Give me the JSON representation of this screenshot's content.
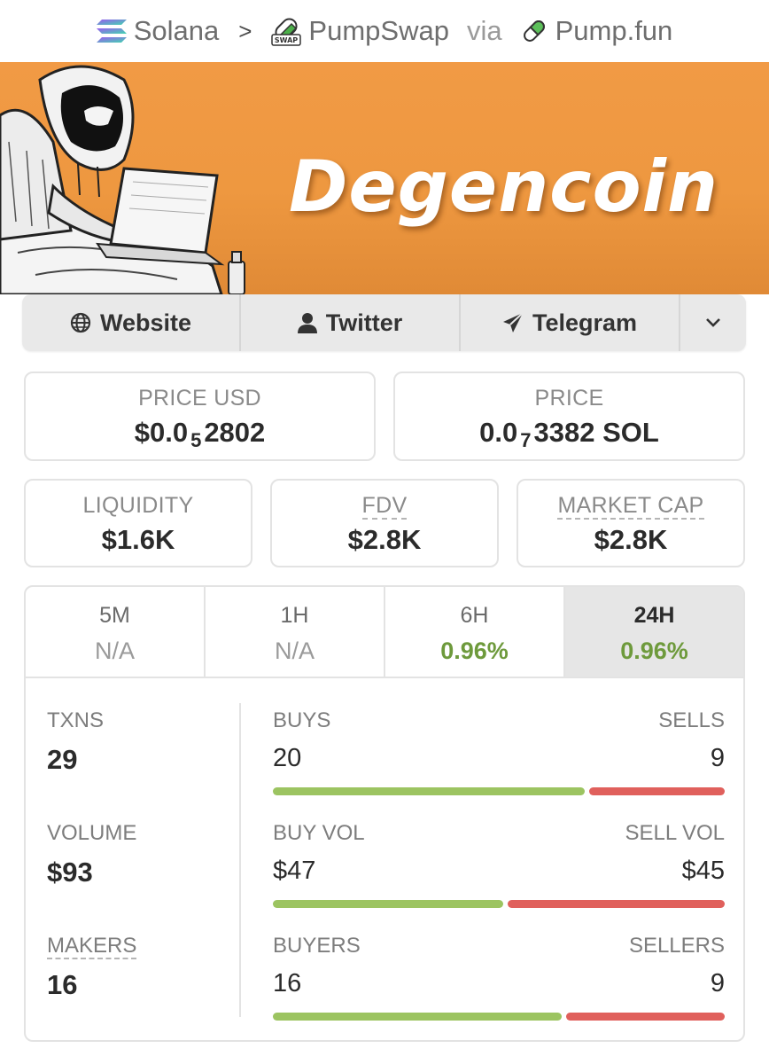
{
  "breadcrumb": {
    "chain": "Solana",
    "dex": "PumpSwap",
    "via": "via",
    "launchpad": "Pump.fun"
  },
  "banner": {
    "title": "Degencoin"
  },
  "links": {
    "website": "Website",
    "twitter": "Twitter",
    "telegram": "Telegram"
  },
  "price": {
    "usd_label": "PRICE USD",
    "usd_prefix": "$0.0",
    "usd_zeros": "5",
    "usd_digits": "2802",
    "native_label": "PRICE",
    "native_prefix": "0.0",
    "native_zeros": "7",
    "native_digits": "3382 SOL"
  },
  "metrics": {
    "liquidity_label": "LIQUIDITY",
    "liquidity_value": "$1.6K",
    "fdv_label": "FDV",
    "fdv_value": "$2.8K",
    "mcap_label": "MARKET CAP",
    "mcap_value": "$2.8K"
  },
  "timeframes": [
    {
      "label": "5M",
      "value": "N/A"
    },
    {
      "label": "1H",
      "value": "N/A"
    },
    {
      "label": "6H",
      "value": "0.96%"
    },
    {
      "label": "24H",
      "value": "0.96%"
    }
  ],
  "active_timeframe": "24H",
  "stats": {
    "txns_label": "TXNS",
    "txns_value": "29",
    "volume_label": "VOLUME",
    "volume_value": "$93",
    "makers_label": "MAKERS",
    "makers_value": "16",
    "buys_label": "BUYS",
    "buys_value": "20",
    "sells_label": "SELLS",
    "sells_value": "9",
    "buyvol_label": "BUY VOL",
    "buyvol_value": "$47",
    "sellvol_label": "SELL VOL",
    "sellvol_value": "$45",
    "buyers_label": "BUYERS",
    "buyers_value": "16",
    "sellers_label": "SELLERS",
    "sellers_value": "9"
  },
  "ratios": {
    "buys_fraction": 0.69,
    "buyvol_fraction": 0.51,
    "buyers_fraction": 0.64
  },
  "colors": {
    "banner": "#f19a45",
    "positive": "#6e9a3c",
    "buy_bar": "#9cc461",
    "sell_bar": "#e0605c"
  },
  "icons": {
    "chain": "solana-icon",
    "dex": "pumpswap-icon",
    "launchpad": "pill-icon",
    "website": "globe-icon",
    "twitter": "user-icon",
    "telegram": "paper-plane-icon",
    "more": "chevron-down-icon"
  }
}
